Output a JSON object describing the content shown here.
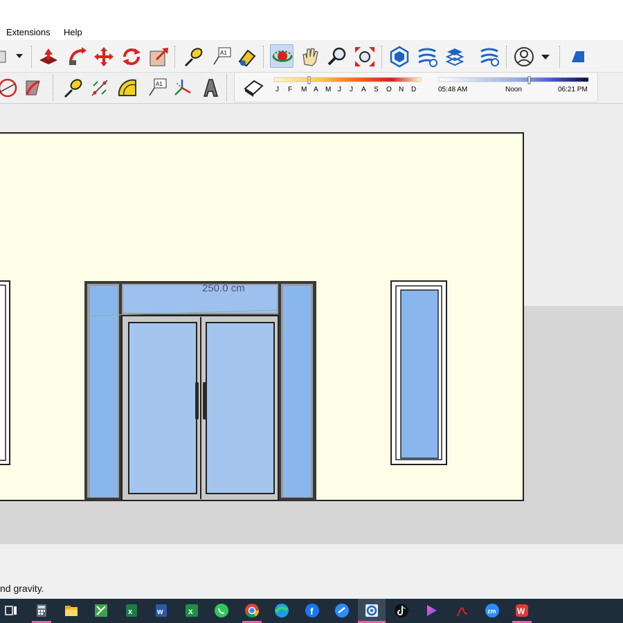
{
  "menu": {
    "extensions": "Extensions",
    "help": "Help"
  },
  "toolbar_row1": [
    "paint-bucket-dropdown-icon",
    "push-pull-icon",
    "follow-me-icon",
    "move-icon",
    "rotate-icon",
    "scale-icon",
    "tape-measure-icon",
    "text-icon",
    "paint-icon",
    "orbit-icon",
    "pan-icon",
    "zoom-icon",
    "zoom-extents-icon",
    "warehouse-icon",
    "extension-warehouse-icon",
    "layout-icon",
    "extension-manager-icon",
    "account-icon",
    "style-icon"
  ],
  "toolbar_row2": [
    "protractor-icon",
    "section-icon",
    "tape-measure-icon",
    "dimension-icon",
    "protractor-icon",
    "text-icon",
    "axes-icon",
    "3d-text-icon",
    "shadow-toggle-icon"
  ],
  "shadow": {
    "months": [
      "J",
      "F",
      "M",
      "A",
      "M",
      "J",
      "J",
      "A",
      "S",
      "O",
      "N",
      "D"
    ],
    "time_start": "05:48 AM",
    "time_mid": "Noon",
    "time_end": "06:21 PM"
  },
  "viewport": {
    "dimension_label": "250.0 cm"
  },
  "status": {
    "text": "nd gravity."
  },
  "taskbar": {
    "icons": [
      "task-view-icon",
      "calculator-icon",
      "file-explorer-icon",
      "sketchup-layout-icon",
      "excel-icon",
      "word-icon",
      "excel-green-icon",
      "whatsapp-icon",
      "chrome-icon",
      "edge-icon",
      "facebook-icon",
      "zoom-blue-icon",
      "sketchup-icon",
      "tiktok-icon",
      "app-gradient-icon",
      "acrobat-icon",
      "zoom-icon",
      "wps-icon"
    ]
  }
}
